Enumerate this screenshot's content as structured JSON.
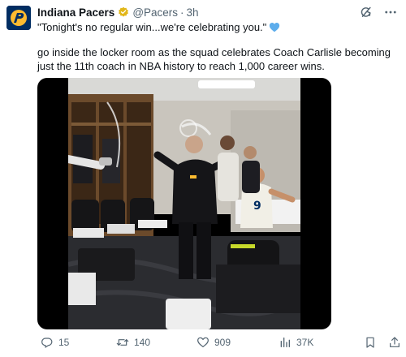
{
  "tweet": {
    "author_name": "Indiana Pacers",
    "handle": "@Pacers",
    "separator": "·",
    "time": "3h",
    "quote_line": "\"Tonight's no regular win...we're celebrating you.\"",
    "body": "go inside the locker room as the squad celebrates Coach Carlisle becoming just the 11th coach in NBA history to reach 1,000 career wins."
  },
  "stats": {
    "replies": "15",
    "reposts": "140",
    "likes": "909",
    "views": "37K"
  },
  "icons": {
    "avatar": "pacers-logo",
    "verified": "verified-badge-icon",
    "heart": "blue-heart-emoji",
    "tools": [
      "grok-icon",
      "more-icon"
    ],
    "actions": [
      "reply-icon",
      "repost-icon",
      "like-icon",
      "views-icon",
      "bookmark-icon",
      "share-icon"
    ]
  },
  "colors": {
    "brand_navy": "#002d62",
    "brand_gold": "#fdbb30",
    "verified_gold": "#e2b719",
    "heart_blue": "#5dadec",
    "text_primary": "#0f1419",
    "text_secondary": "#536471"
  }
}
